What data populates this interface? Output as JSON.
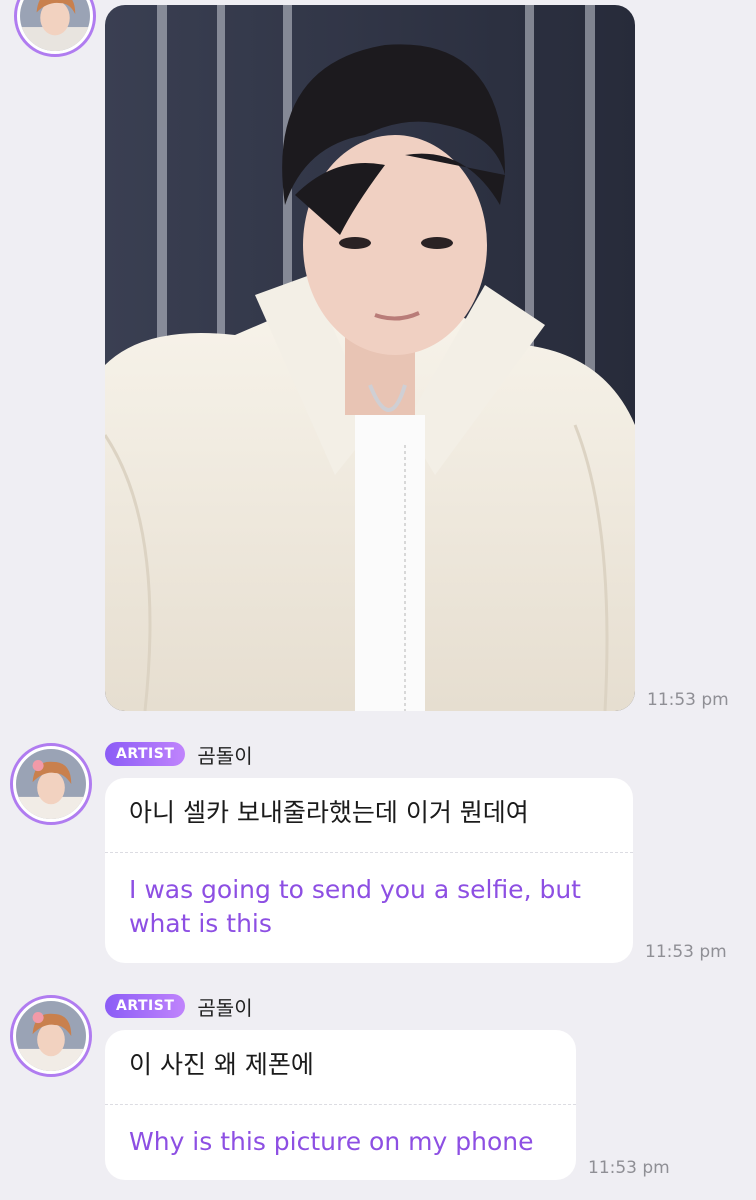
{
  "messages": [
    {
      "type": "image",
      "image_label": "selfie-photo",
      "time": "11:53 pm"
    },
    {
      "type": "text",
      "badge": "ARTIST",
      "sender": "곰돌이",
      "original": "아니 셀카 보내줄라했는데 이거 뭔데여",
      "translation": "I was going to send you a selfie, but what is this",
      "time": "11:53 pm"
    },
    {
      "type": "text",
      "badge": "ARTIST",
      "sender": "곰돌이",
      "original": "이 사진 왜 제폰에",
      "translation": "Why is this picture on my phone",
      "time": "11:53 pm"
    }
  ],
  "colors": {
    "background": "#efeef3",
    "bubble": "#ffffff",
    "translation_text": "#8d4fe3",
    "badge_gradient_start": "#8b5cf6",
    "badge_gradient_end": "#c084fc",
    "avatar_ring": "#b07cf0",
    "timestamp": "#8f8f95"
  }
}
